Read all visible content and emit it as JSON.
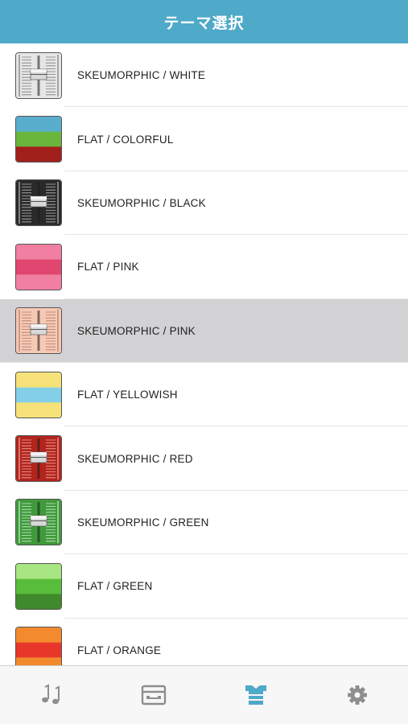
{
  "header": {
    "title": "テーマ選択"
  },
  "themes": [
    {
      "label": "SKEUMORPHIC / WHITE",
      "style": "skeu",
      "bg": "#e6e6e6",
      "line": "#7a7a7a",
      "icon": "skeumorphic-white-thumbnail-icon"
    },
    {
      "label": "FLAT / COLORFUL",
      "style": "flat",
      "bands": [
        "#5aaecd",
        "#6ab53c",
        "#a1201c"
      ],
      "icon": "flat-colorful-thumbnail-icon"
    },
    {
      "label": "SKEUMORPHIC / BLACK",
      "style": "skeu",
      "bg": "#2a2a2a",
      "line": "#bdbdbd",
      "icon": "skeumorphic-black-thumbnail-icon"
    },
    {
      "label": "FLAT / PINK",
      "style": "flat",
      "bands": [
        "#f07fa2",
        "#e0466f",
        "#f07fa2"
      ],
      "icon": "flat-pink-thumbnail-icon"
    },
    {
      "label": "SKEUMORPHIC / PINK",
      "style": "skeu",
      "bg": "#f6c9b5",
      "line": "#b07a6a",
      "selected": true,
      "icon": "skeumorphic-pink-thumbnail-icon"
    },
    {
      "label": "FLAT / YELLOWISH",
      "style": "flat",
      "bands": [
        "#f7e27a",
        "#83cfe8",
        "#f7e27a"
      ],
      "icon": "flat-yellowish-thumbnail-icon"
    },
    {
      "label": "SKEUMORPHIC / RED",
      "style": "skeu",
      "bg": "#b3241d",
      "line": "#f0b0a8",
      "icon": "skeumorphic-red-thumbnail-icon"
    },
    {
      "label": "SKEUMORPHIC / GREEN",
      "style": "skeu",
      "bg": "#3f9a3b",
      "line": "#cfeecf",
      "icon": "skeumorphic-green-thumbnail-icon"
    },
    {
      "label": "FLAT / GREEN",
      "style": "flat",
      "bands": [
        "#a7e682",
        "#58bd3b",
        "#3f8a2c"
      ],
      "icon": "flat-green-thumbnail-icon"
    },
    {
      "label": "FLAT / ORANGE",
      "style": "flat",
      "bands": [
        "#f38a2e",
        "#e8362a",
        "#f38a2e"
      ],
      "icon": "flat-orange-thumbnail-icon"
    }
  ],
  "tabbar": {
    "active_color": "#4fa9c8",
    "inactive_color": "#8e8e8e",
    "tabs": [
      {
        "icon": "music-notes-icon",
        "active": false
      },
      {
        "icon": "device-icon",
        "active": false
      },
      {
        "icon": "shirt-icon",
        "active": true
      },
      {
        "icon": "gear-icon",
        "active": false
      }
    ]
  }
}
